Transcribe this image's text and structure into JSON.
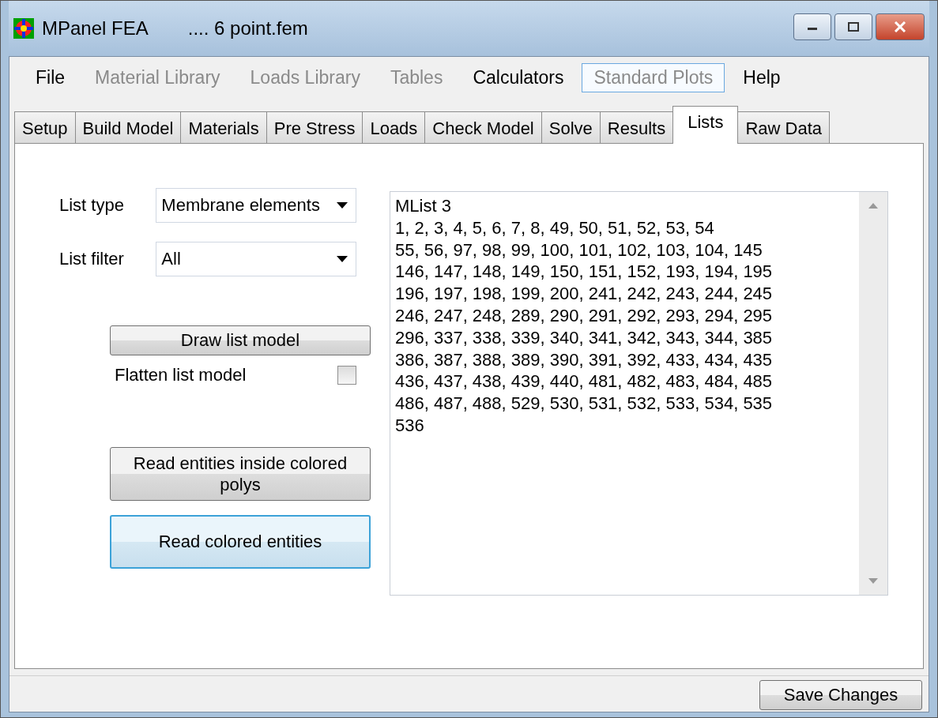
{
  "window": {
    "title": "MPanel FEA",
    "title_suffix": ".... 6 point.fem"
  },
  "menu": [
    {
      "label": "File",
      "disabled": false,
      "highlighted": false
    },
    {
      "label": "Material Library",
      "disabled": true,
      "highlighted": false
    },
    {
      "label": "Loads Library",
      "disabled": true,
      "highlighted": false
    },
    {
      "label": "Tables",
      "disabled": true,
      "highlighted": false
    },
    {
      "label": "Calculators",
      "disabled": false,
      "highlighted": false
    },
    {
      "label": "Standard Plots",
      "disabled": true,
      "highlighted": true
    },
    {
      "label": "Help",
      "disabled": false,
      "highlighted": false
    }
  ],
  "tabs": [
    {
      "label": "Setup",
      "selected": false
    },
    {
      "label": "Build Model",
      "selected": false
    },
    {
      "label": "Materials",
      "selected": false
    },
    {
      "label": "Pre Stress",
      "selected": false
    },
    {
      "label": "Loads",
      "selected": false
    },
    {
      "label": "Check Model",
      "selected": false
    },
    {
      "label": "Solve",
      "selected": false
    },
    {
      "label": "Results",
      "selected": false
    },
    {
      "label": "Lists",
      "selected": true
    },
    {
      "label": "Raw Data",
      "selected": false
    }
  ],
  "list_type": {
    "label": "List type",
    "value": "Membrane elements"
  },
  "list_filter": {
    "label": "List filter",
    "value": "All"
  },
  "draw_button": "Draw list model",
  "flatten": {
    "label": "Flatten list model",
    "checked": false
  },
  "action_buttons": [
    {
      "label": "Read entities inside colored polys",
      "focused": false
    },
    {
      "label": "Read colored entities",
      "focused": true
    }
  ],
  "list_text": [
    "MList 3",
    "1, 2, 3, 4, 5, 6, 7, 8, 49, 50, 51, 52, 53, 54",
    "55, 56, 97, 98, 99, 100, 101, 102, 103, 104, 145",
    "146, 147, 148, 149, 150, 151, 152, 193, 194, 195",
    "196, 197, 198, 199, 200, 241, 242, 243, 244, 245",
    "246, 247, 248, 289, 290, 291, 292, 293, 294, 295",
    "296, 337, 338, 339, 340, 341, 342, 343, 344, 385",
    "386, 387, 388, 389, 390, 391, 392, 433, 434, 435",
    "436, 437, 438, 439, 440, 481, 482, 483, 484, 485",
    "486, 487, 488, 529, 530, 531, 532, 533, 534, 535",
    "536"
  ],
  "save_button": "Save Changes"
}
